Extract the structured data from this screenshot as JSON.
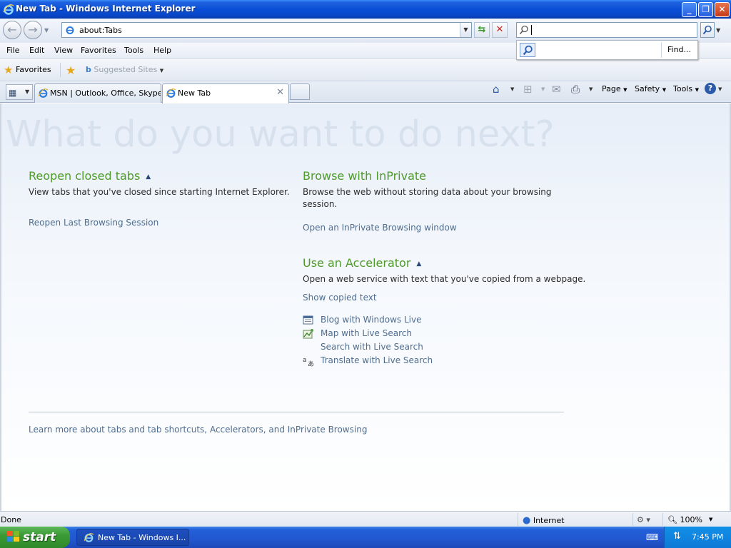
{
  "window": {
    "title": "New Tab - Windows Internet Explorer"
  },
  "toolbar": {
    "address": "about:Tabs",
    "search_value": "",
    "search_find": "Find..."
  },
  "menu": [
    "File",
    "Edit",
    "View",
    "Favorites",
    "Tools",
    "Help"
  ],
  "favorites_bar": {
    "favorites_label": "Favorites",
    "suggested_sites_label": "Suggested Sites"
  },
  "tabs": [
    {
      "label": "MSN | Outlook, Office, Skype...",
      "active": false
    },
    {
      "label": "New Tab",
      "active": true
    }
  ],
  "command_bar": {
    "page_label": "Page",
    "safety_label": "Safety",
    "tools_label": "Tools"
  },
  "content": {
    "heading": "What do you want to do next?",
    "reopen": {
      "title": "Reopen closed tabs",
      "desc": "View tabs that you've closed since starting Internet Explorer.",
      "link": "Reopen Last Browsing Session"
    },
    "inprivate": {
      "title": "Browse with InPrivate",
      "desc": "Browse the web without storing data about your browsing session.",
      "link": "Open an InPrivate Browsing window"
    },
    "accelerator": {
      "title": "Use an Accelerator",
      "desc": "Open a web service with text that you've copied from a webpage.",
      "link": "Show copied text",
      "items": [
        {
          "label": "Blog with Windows Live",
          "icon": "blog-icon"
        },
        {
          "label": "Map with Live Search",
          "icon": "map-icon"
        },
        {
          "label": "Search with Live Search",
          "icon": ""
        },
        {
          "label": "Translate with Live Search",
          "icon": "translate-icon"
        }
      ]
    },
    "footer_link": "Learn more about tabs and tab shortcuts, Accelerators, and InPrivate Browsing"
  },
  "status": {
    "text": "Done",
    "zone": "Internet",
    "zoom": "100%"
  },
  "taskbar": {
    "start_label": "start",
    "task_label": "New Tab - Windows I...",
    "clock": "7:45 PM"
  },
  "colors": {
    "title_bar": "#0a4fd6",
    "section_title": "#4e9a2a",
    "link": "#4f6d8f",
    "start_button": "#3b9a35"
  }
}
